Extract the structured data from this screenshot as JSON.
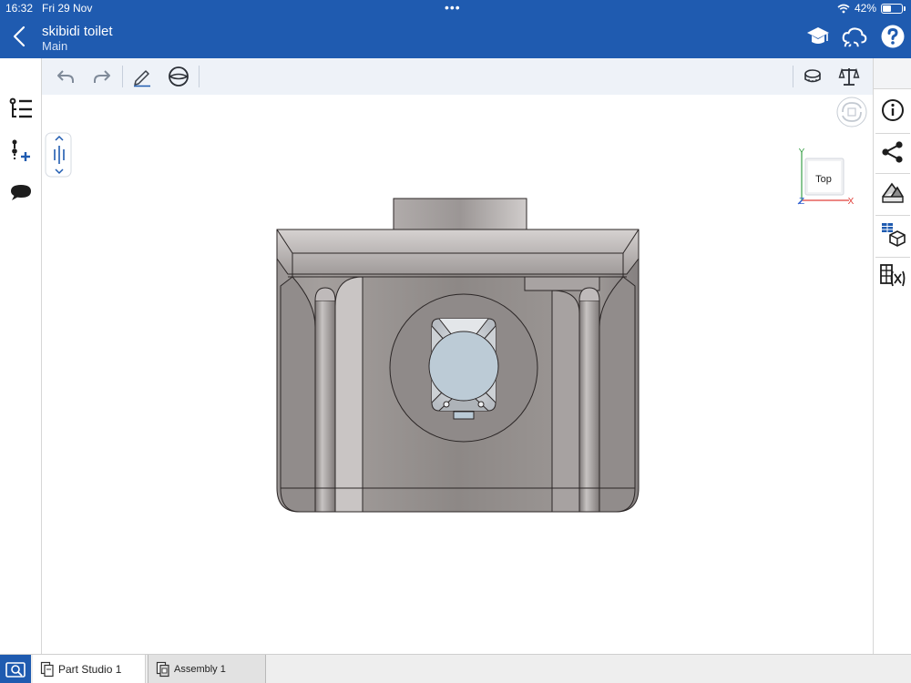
{
  "status_bar": {
    "time": "16:32",
    "date": "Fri 29 Nov",
    "battery": "42%"
  },
  "header": {
    "title": "skibidi toilet",
    "subtitle": "Main"
  },
  "view_cube": {
    "face": "Top",
    "axis_x": "X",
    "axis_y": "Y",
    "axis_z": "Z"
  },
  "tabs": [
    {
      "label": "Part Studio 1",
      "active": true
    },
    {
      "label": "Assembly 1",
      "active": false
    }
  ],
  "colors": {
    "brand_blue": "#1f5bb0",
    "part_gray": "#8f8a88",
    "axis_x": "#e0403a",
    "axis_y": "#3aa048",
    "axis_z": "#2f5fd0"
  }
}
